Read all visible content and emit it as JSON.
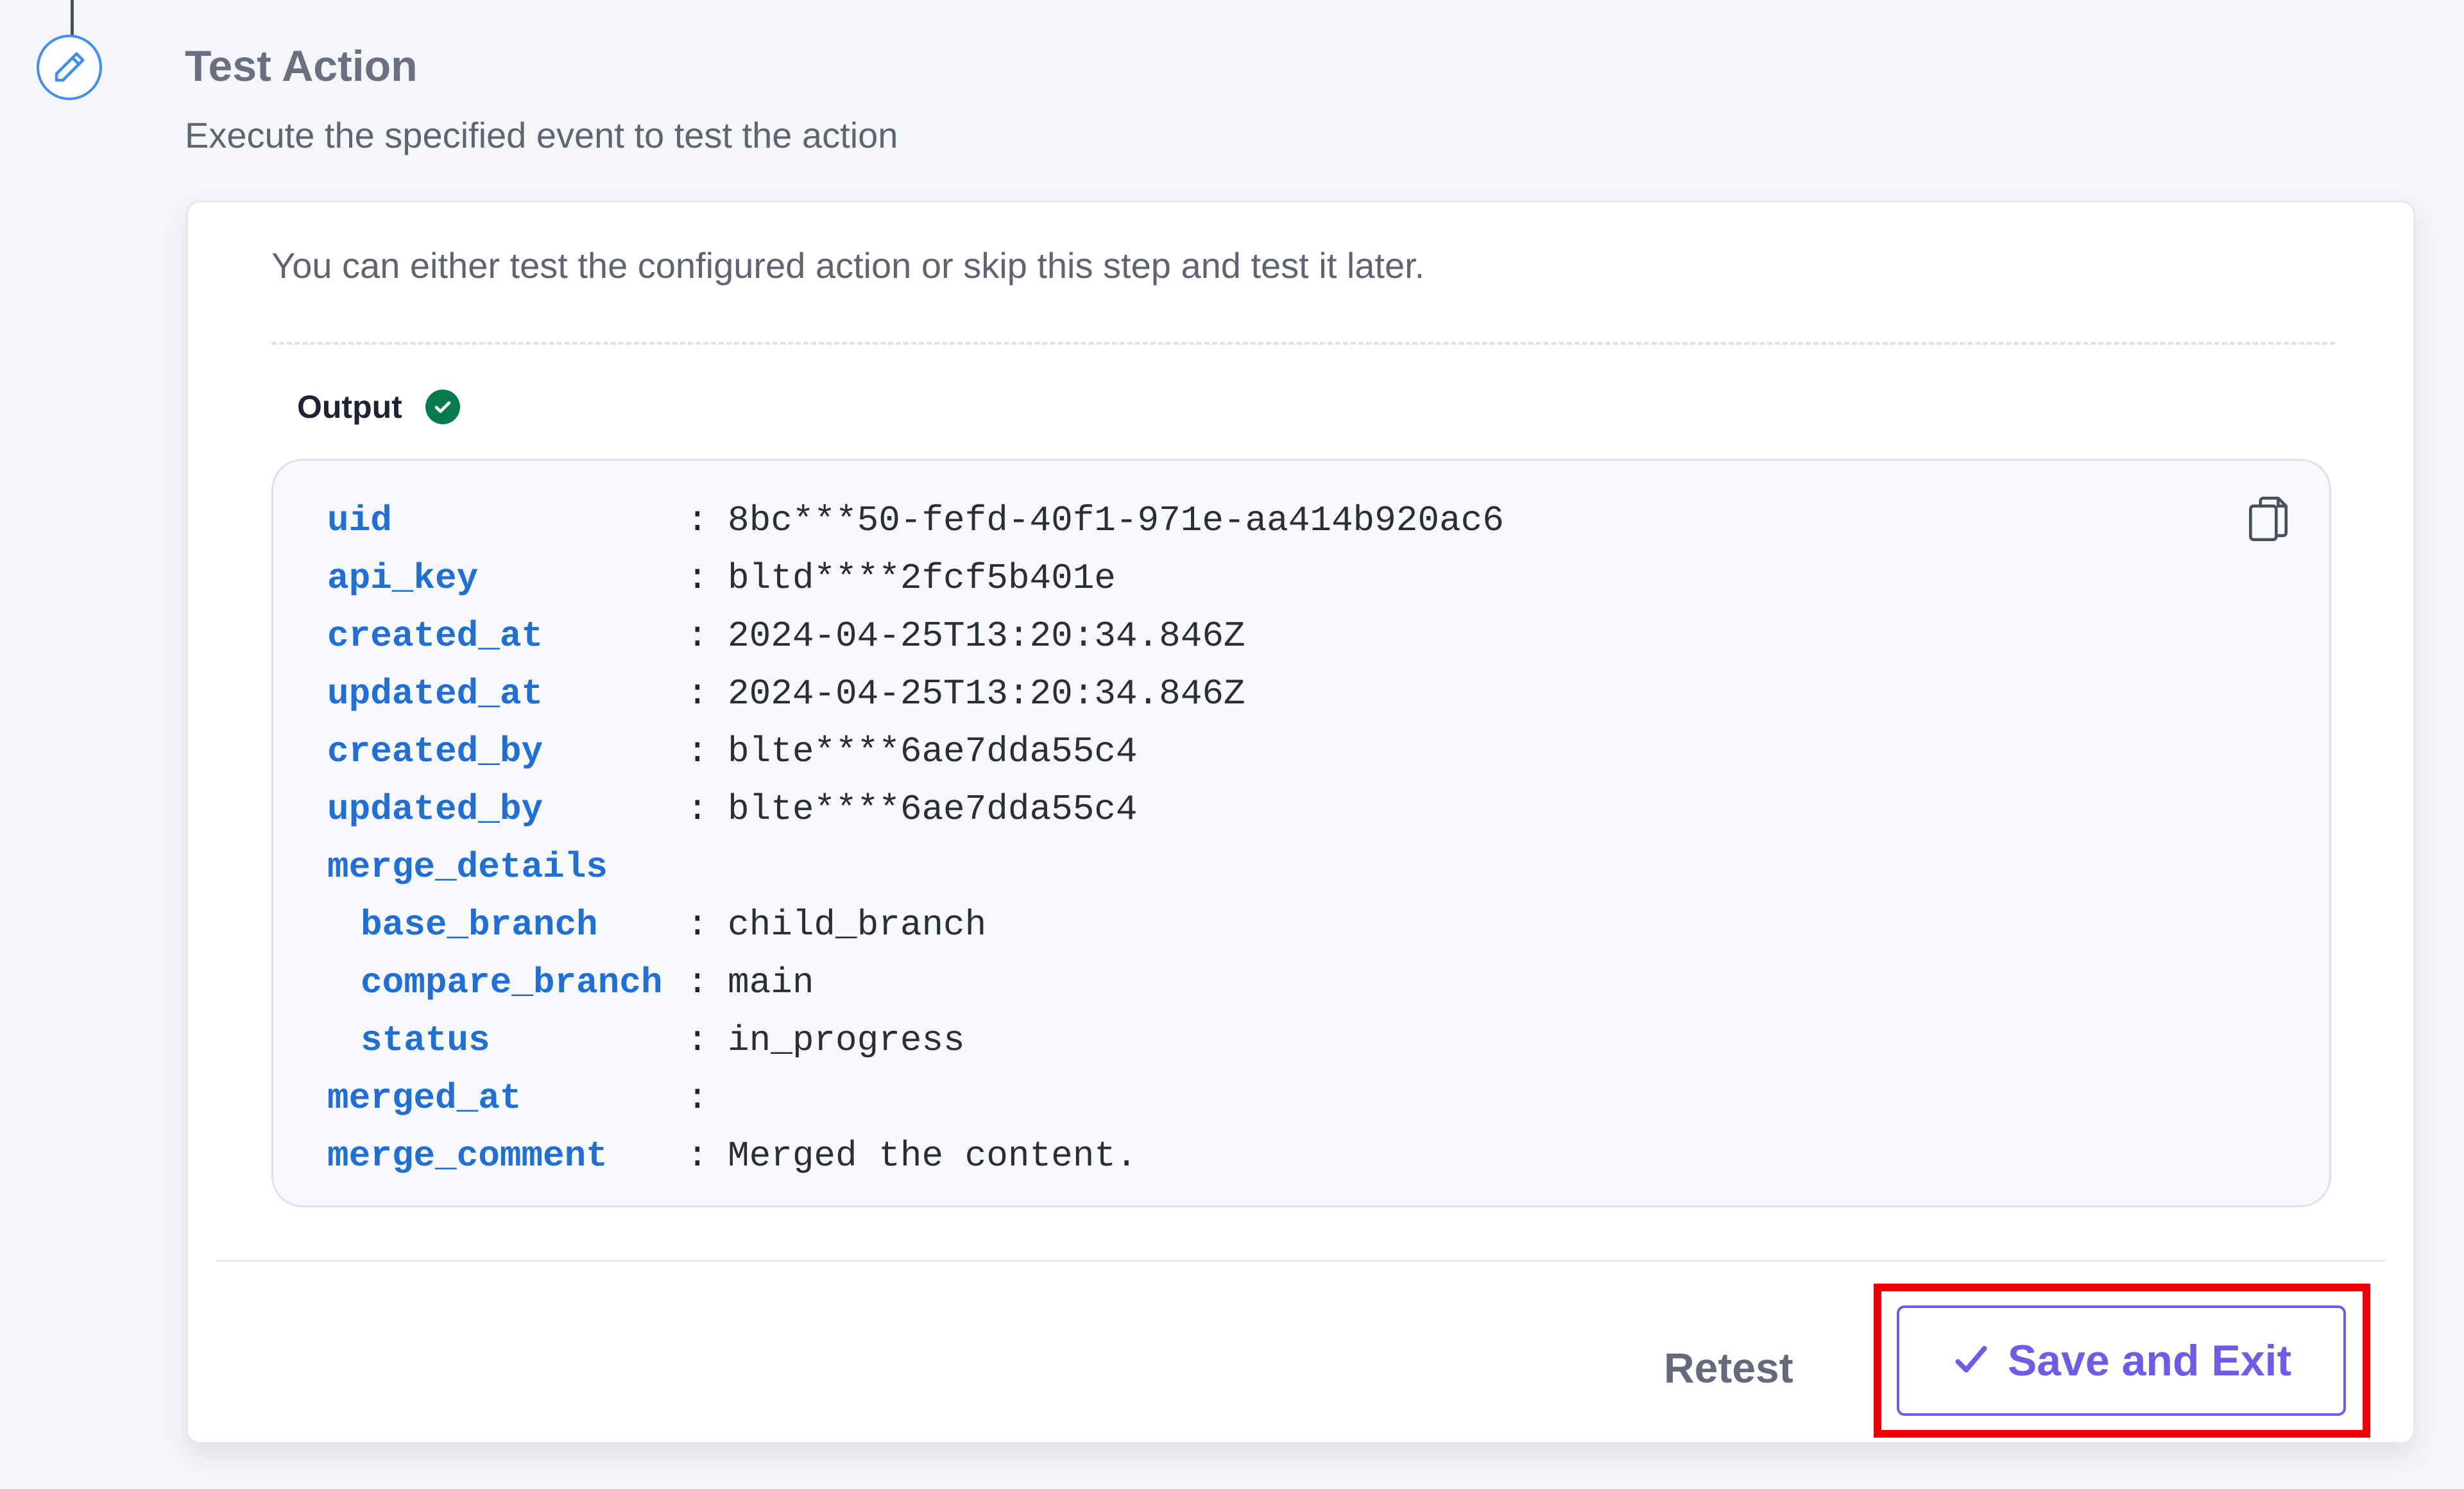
{
  "step": {
    "title": "Test Action",
    "subtitle": "Execute the specified event to test the action",
    "icon": "pencil-icon"
  },
  "card": {
    "intro": "You can either test the configured action or skip this step and test it later.",
    "output_label": "Output",
    "output_status_icon": "check-circle-icon",
    "copy_icon": "copy-icon"
  },
  "output": {
    "rows": [
      {
        "key": "uid",
        "sep": ":",
        "value": "8bc***50-fefd-40f1-971e-aa414b920ac6"
      },
      {
        "key": "api_key",
        "sep": ":",
        "value": "bltd****2fcf5b401e"
      },
      {
        "key": "created_at",
        "sep": ":",
        "value": "2024-04-25T13:20:34.846Z"
      },
      {
        "key": "updated_at",
        "sep": ":",
        "value": "2024-04-25T13:20:34.846Z"
      },
      {
        "key": "created_by",
        "sep": ":",
        "value": "blte****6ae7dda55c4"
      },
      {
        "key": "updated_by",
        "sep": ":",
        "value": "blte****6ae7dda55c4"
      },
      {
        "key": "merge_details",
        "sep": "",
        "value": ""
      },
      {
        "key": "base_branch",
        "sep": ":",
        "value": "child_branch"
      },
      {
        "key": "compare_branch",
        "sep": ":",
        "value": "main"
      },
      {
        "key": "status",
        "sep": ":",
        "value": "in_progress"
      },
      {
        "key": "merged_at",
        "sep": ":",
        "value": ""
      },
      {
        "key": "merge_comment",
        "sep": ":",
        "value": "Merged the content."
      }
    ]
  },
  "footer": {
    "retest_label": "Retest",
    "save_label": "Save and Exit",
    "save_icon": "checkmark-icon"
  },
  "colors": {
    "accent": "#6c5ce7",
    "key": "#1f6fd6",
    "success": "#057a4f",
    "highlight": "#ee0008",
    "step_icon": "#3f8ff3"
  }
}
